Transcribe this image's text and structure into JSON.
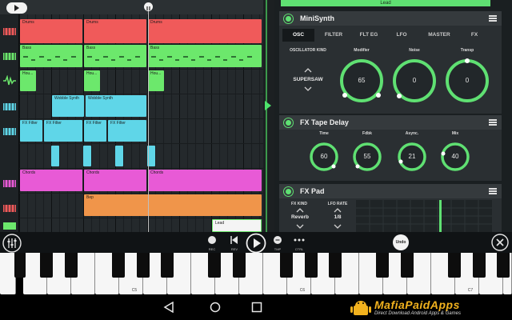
{
  "playlist": {
    "clips": [
      {
        "label": "Drums"
      },
      {
        "label": "Drums"
      },
      {
        "label": "Drums"
      },
      {
        "label": "Bass"
      },
      {
        "label": "Bass"
      },
      {
        "label": "Bass"
      },
      {
        "label": "Hou..."
      },
      {
        "label": "Hou..."
      },
      {
        "label": "Hou..."
      },
      {
        "label": "Wobble Synth"
      },
      {
        "label": "Wobble Synth"
      },
      {
        "label": "FX Filter"
      },
      {
        "label": "FX Filter"
      },
      {
        "label": "FX Filter"
      },
      {
        "label": "FX Filter"
      },
      {
        "label": "Chords"
      },
      {
        "label": "Chords"
      },
      {
        "label": "Chords"
      },
      {
        "label": "Bep"
      },
      {
        "label": "Lead"
      }
    ]
  },
  "right_panel": {
    "lead_strip": "Lead",
    "minisynth": {
      "title": "MiniSynth",
      "tabs": [
        "OSC",
        "FILTER",
        "FLT EG",
        "LFO",
        "MASTER",
        "FX"
      ],
      "active_tab": "OSC",
      "osc_kind_label": "OSCILLATOR KIND",
      "osc_kind_value": "SUPERSAW",
      "knobs": [
        {
          "label": "Modifier",
          "value": "65"
        },
        {
          "label": "Noise",
          "value": "0"
        },
        {
          "label": "Transp",
          "value": "0"
        }
      ]
    },
    "tape_delay": {
      "title": "FX Tape Delay",
      "knobs": [
        {
          "label": "Time",
          "value": "60"
        },
        {
          "label": "Fdbk",
          "value": "55"
        },
        {
          "label": "Async.",
          "value": "21"
        },
        {
          "label": "Mix",
          "value": "40"
        }
      ]
    },
    "fx_pad": {
      "title": "FX Pad",
      "fx_kind_label": "FX KIND",
      "fx_kind_value": "Reverb",
      "lfo_rate_label": "LFO RATE",
      "lfo_rate_value": "1/8"
    }
  },
  "transport": {
    "buttons": [
      {
        "label": "REC"
      },
      {
        "label": "REV"
      },
      {
        "label": "TMP"
      },
      {
        "label": "CTRL"
      }
    ],
    "undo": "Undo"
  },
  "keyboard": {
    "octave_labels": [
      "C5",
      "C6",
      "C7"
    ]
  },
  "watermark": {
    "main": "MafiaPaidApps",
    "sub": "Direct Download Android Apps & Games"
  },
  "colors": {
    "accent_green": "#5fe072",
    "drums_red": "#f05a5a",
    "bass_green": "#6ce86c",
    "synth_cyan": "#5fd6e8",
    "chords_magenta": "#e85ad6",
    "bep_orange": "#f0954a"
  }
}
